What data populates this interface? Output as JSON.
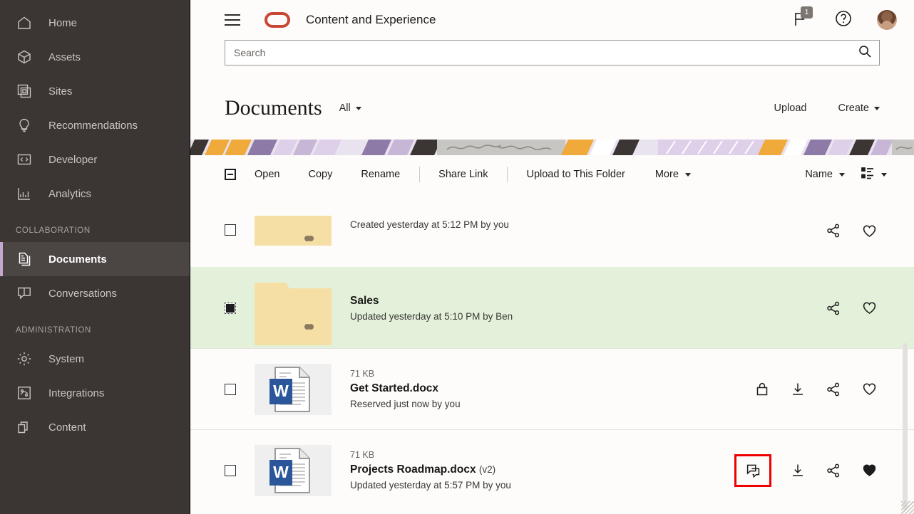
{
  "sidebar": {
    "items": [
      {
        "label": "Home",
        "icon": "home-icon",
        "active": false
      },
      {
        "label": "Assets",
        "icon": "cube-icon",
        "active": false
      },
      {
        "label": "Sites",
        "icon": "sites-icon",
        "active": false
      },
      {
        "label": "Recommendations",
        "icon": "lightbulb-icon",
        "active": false
      },
      {
        "label": "Developer",
        "icon": "code-icon",
        "active": false
      },
      {
        "label": "Analytics",
        "icon": "analytics-icon",
        "active": false
      }
    ],
    "section_collaboration": "COLLABORATION",
    "collab_items": [
      {
        "label": "Documents",
        "icon": "documents-icon",
        "active": true
      },
      {
        "label": "Conversations",
        "icon": "conversations-icon",
        "active": false
      }
    ],
    "section_administration": "ADMINISTRATION",
    "admin_items": [
      {
        "label": "System",
        "icon": "gear-icon",
        "active": false
      },
      {
        "label": "Integrations",
        "icon": "integrations-icon",
        "active": false
      },
      {
        "label": "Content",
        "icon": "content-icon",
        "active": false
      }
    ]
  },
  "appbar": {
    "menu_icon": "hamburger-icon",
    "logo": "oracle-logo",
    "title": "Content and Experience",
    "flag_icon": "flag-icon",
    "flag_badge": "1",
    "help_icon": "help-icon",
    "avatar": "user-avatar"
  },
  "search": {
    "placeholder": "Search",
    "value": "",
    "icon": "search-icon"
  },
  "page": {
    "title": "Documents",
    "filter_label": "All",
    "upload_label": "Upload",
    "create_label": "Create"
  },
  "toolbar": {
    "select_all_icon": "indeterminate-checkbox-icon",
    "items": [
      {
        "label": "Open"
      },
      {
        "label": "Copy"
      },
      {
        "label": "Rename"
      },
      {
        "label": "Share Link"
      },
      {
        "label": "Upload to This Folder"
      },
      {
        "label": "More",
        "caret": true
      }
    ],
    "sort_label": "Name",
    "view_icon": "list-view-icon"
  },
  "list": {
    "rows": [
      {
        "type": "folder",
        "partial": true,
        "checked": false,
        "name": "",
        "size": "",
        "version": "",
        "sub": "Created yesterday at 5:12 PM by you",
        "icons": [
          "share-icon",
          "favorite-outline-icon"
        ]
      },
      {
        "type": "folder",
        "partial": false,
        "checked": true,
        "selected": true,
        "name": "Sales",
        "size": "",
        "version": "",
        "sub": "Updated yesterday at 5:10 PM by Ben",
        "icons": [
          "share-icon",
          "favorite-outline-icon"
        ]
      },
      {
        "type": "docx",
        "partial": false,
        "checked": false,
        "name": "Get Started.docx",
        "size": "71 KB",
        "version": "",
        "sub": "Reserved just now by you",
        "icons": [
          "lock-icon",
          "download-icon",
          "share-icon",
          "favorite-outline-icon"
        ]
      },
      {
        "type": "docx",
        "partial": false,
        "checked": false,
        "name": "Projects Roadmap.docx",
        "size": "71 KB",
        "version": "(v2)",
        "sub": "Updated yesterday at 5:57 PM by you",
        "icons": [
          "conversation-icon",
          "download-icon",
          "share-icon",
          "favorite-filled-icon"
        ],
        "highlight_icon_index": 0
      }
    ]
  },
  "colors": {
    "sidebar_bg": "#3b3633",
    "sidebar_active_bg": "#4b4643",
    "accent_purple": "#c4a8cf",
    "oracle_red": "#c74634",
    "row_selected_bg": "#e3f1da",
    "highlight_box": "#ee0000",
    "folder": "#f5dfa5",
    "word_blue": "#2b579a"
  }
}
